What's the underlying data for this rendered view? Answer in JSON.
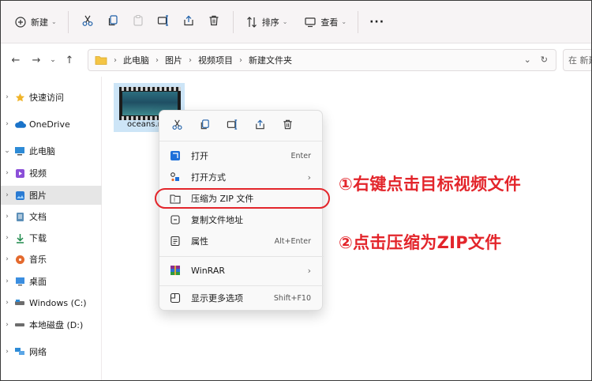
{
  "toolbar": {
    "new_label": "新建",
    "sort_label": "排序",
    "view_label": "查看",
    "more_label": "···"
  },
  "breadcrumb": [
    "此电脑",
    "图片",
    "视频项目",
    "新建文件夹"
  ],
  "search": {
    "placeholder": "在 新建"
  },
  "sidebar": {
    "items": [
      {
        "label": "快速访问",
        "icon": "star-icon"
      },
      {
        "label": "OneDrive",
        "icon": "cloud-icon"
      },
      {
        "label": "此电脑",
        "icon": "computer-icon"
      },
      {
        "label": "视频",
        "icon": "video-folder-icon"
      },
      {
        "label": "图片",
        "icon": "pictures-folder-icon"
      },
      {
        "label": "文档",
        "icon": "documents-folder-icon"
      },
      {
        "label": "下载",
        "icon": "download-icon"
      },
      {
        "label": "音乐",
        "icon": "music-icon"
      },
      {
        "label": "桌面",
        "icon": "desktop-icon"
      },
      {
        "label": "Windows (C:)",
        "icon": "drive-c-icon"
      },
      {
        "label": "本地磁盘 (D:)",
        "icon": "drive-d-icon"
      },
      {
        "label": "网络",
        "icon": "network-icon"
      }
    ]
  },
  "file": {
    "name": "oceans.n"
  },
  "context_menu": {
    "items": [
      {
        "label": "打开",
        "shortcut": "Enter"
      },
      {
        "label": "打开方式",
        "shortcut": ""
      },
      {
        "label": "压缩为 ZIP 文件",
        "shortcut": ""
      },
      {
        "label": "复制文件地址",
        "shortcut": ""
      },
      {
        "label": "属性",
        "shortcut": "Alt+Enter"
      },
      {
        "label": "WinRAR",
        "shortcut": ""
      },
      {
        "label": "显示更多选项",
        "shortcut": "Shift+F10"
      }
    ]
  },
  "annotations": {
    "step1": "①右键点击目标视频文件",
    "step2": "②点击压缩为ZIP文件"
  },
  "colors": {
    "accent": "#e3252b",
    "selection": "#cde5f7",
    "folder": "#f4c545"
  }
}
